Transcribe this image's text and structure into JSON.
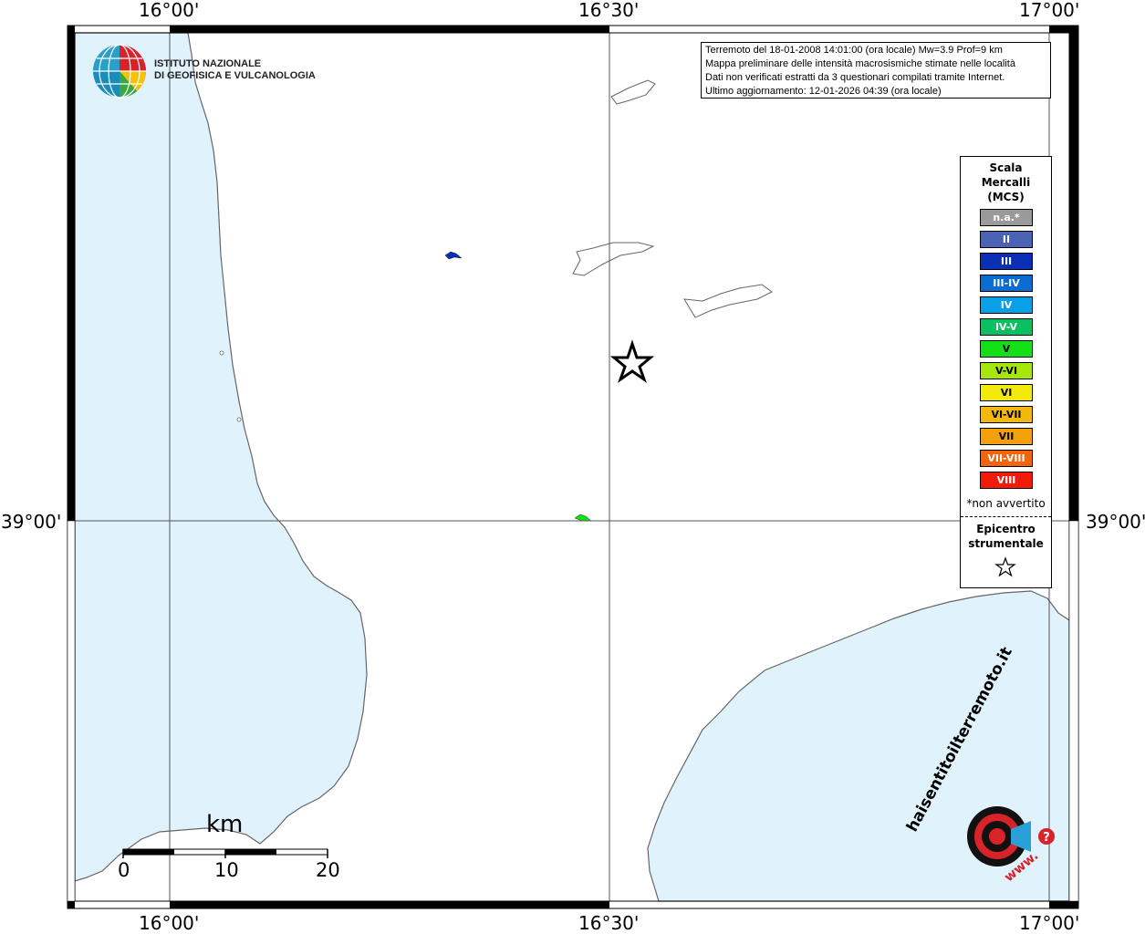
{
  "map": {
    "coords": {
      "top": [
        "16°00'",
        "16°30'",
        "17°00'"
      ],
      "bottom": [
        "16°00'",
        "16°30'",
        "17°00'"
      ],
      "left": "39°00'",
      "right": "39°00'"
    },
    "colors": {
      "sea": "#e0f2fc",
      "land": "#ffffff",
      "coast": "#666666"
    }
  },
  "logo": {
    "line1": "ISTITUTO NAZIONALE",
    "line2": "DI GEOFISICA E VULCANOLOGIA"
  },
  "info": {
    "line1": "Terremoto del 18-01-2008 14:01:00 (ora locale) Mw=3.9 Prof=9 km",
    "line2": "Mappa preliminare delle intensità macrosismiche stimate nelle località",
    "line3": "Dati non verificati estratti da 3 questionari compilati tramite Internet.",
    "line4": "Ultimo aggiornamento: 12-01-2026 04:39 (ora locale)"
  },
  "legend": {
    "title1": "Scala",
    "title2": "Mercalli",
    "title3": "(MCS)",
    "items": [
      {
        "label": "n.a.*",
        "color": "#9a9a9a"
      },
      {
        "label": "II",
        "color": "#4a63b4"
      },
      {
        "label": "III",
        "color": "#0a2fb4"
      },
      {
        "label": "III-IV",
        "color": "#0a6ccf"
      },
      {
        "label": "IV",
        "color": "#0aa0e8"
      },
      {
        "label": "IV-V",
        "color": "#0ac060"
      },
      {
        "label": "V",
        "color": "#14e01a"
      },
      {
        "label": "V-VI",
        "color": "#a6e60a"
      },
      {
        "label": "VI",
        "color": "#f4ea0a"
      },
      {
        "label": "VI-VII",
        "color": "#f4b80a"
      },
      {
        "label": "VII",
        "color": "#f4a00a"
      },
      {
        "label": "VII-VIII",
        "color": "#f4640a"
      },
      {
        "label": "VIII",
        "color": "#f41a0a"
      }
    ],
    "note": "*non avvertito",
    "epicentro1": "Epicentro",
    "epicentro2": "strumentale"
  },
  "scale": {
    "title": "km",
    "labels": [
      "0",
      "10",
      "20"
    ]
  },
  "hst": {
    "text": "haisentitoilterremoto.it",
    "www": "www."
  }
}
